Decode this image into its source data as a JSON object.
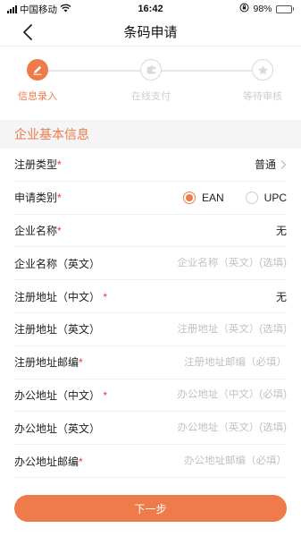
{
  "status_bar": {
    "carrier": "中国移动",
    "time": "16:42",
    "battery_percent": "98%",
    "battery_level": 0.98,
    "icons": [
      "signal-icon",
      "wifi-icon",
      "orientation-lock-icon",
      "battery-icon"
    ]
  },
  "nav": {
    "title": "条码申请",
    "back_icon": "chevron-left-icon"
  },
  "steps": [
    {
      "label": "信息录入",
      "icon": "pencil-icon",
      "active": true
    },
    {
      "label": "在线支付",
      "icon": "wallet-icon",
      "active": false
    },
    {
      "label": "等待审核",
      "icon": "star-icon",
      "active": false
    }
  ],
  "section": {
    "title": "企业基本信息"
  },
  "form": {
    "registration_type": {
      "label": "注册类型",
      "required_mark": "*",
      "value": "普通"
    },
    "application_category": {
      "label": "申请类别",
      "required_mark": "*",
      "options": [
        {
          "label": "EAN",
          "checked": true
        },
        {
          "label": "UPC",
          "checked": false
        }
      ]
    },
    "company_name": {
      "label": "企业名称",
      "required_mark": "*",
      "value": "无"
    },
    "company_name_en": {
      "label": "企业名称（英文）",
      "placeholder": "企业名称（英文）(选填)",
      "value": ""
    },
    "reg_address_cn": {
      "label": "注册地址（中文）",
      "required_mark": "*",
      "value": "无"
    },
    "reg_address_en": {
      "label": "注册地址（英文）",
      "placeholder": "注册地址（英文）(选填)",
      "value": ""
    },
    "reg_postcode": {
      "label": "注册地址邮编",
      "required_mark": "*",
      "placeholder": "注册地址邮编（必填）",
      "value": ""
    },
    "office_address_cn": {
      "label": "办公地址（中文）",
      "required_mark": "*",
      "placeholder": "办公地址（中文）(必填)",
      "value": ""
    },
    "office_address_en": {
      "label": "办公地址（英文）",
      "placeholder": "办公地址（英文）(选填)",
      "value": ""
    },
    "office_postcode": {
      "label": "办公地址邮编",
      "required_mark": "*",
      "placeholder": "办公地址邮编（必填）",
      "value": ""
    }
  },
  "footer": {
    "next_label": "下一步"
  },
  "colors": {
    "accent": "#ee7b49",
    "required": "#e53935",
    "placeholder": "#c2c2c2",
    "section_bg": "#f5f5f5"
  }
}
